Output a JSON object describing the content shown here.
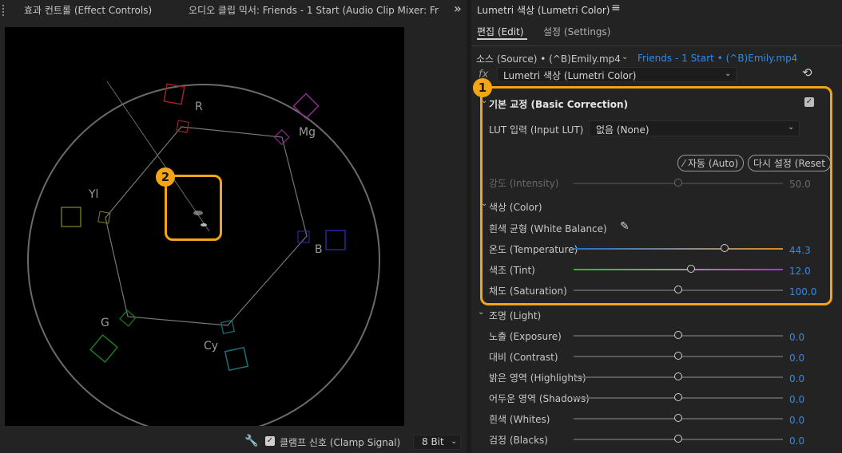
{
  "left_panel": {
    "tabs": [
      {
        "label": "효과 컨트롤 (Effect Controls)"
      },
      {
        "label": "오디오 클립 믹서: Friends - 1 Start (Audio Clip Mixer: Fr"
      }
    ],
    "overflow_symbol": "»",
    "scope_labels": {
      "r": "R",
      "mg": "Mg",
      "yl": "Yl",
      "b": "B",
      "g": "G",
      "cy": "Cy"
    },
    "footer": {
      "clamp_label": "클램프 신호 (Clamp Signal)",
      "clamp_checked": true,
      "bit_depth": "8 Bit"
    }
  },
  "right_panel": {
    "title": "Lumetri 색상 (Lumetri Color)",
    "menu_symbol": "≡",
    "tabs": [
      {
        "label": "편집 (Edit)",
        "active": true
      },
      {
        "label": "설정 (Settings)",
        "active": false
      }
    ],
    "source": {
      "label": "소스 (Source) • (^B)Emily.mp4",
      "sequence": "Friends - 1 Start • (^B)Emily.mp4"
    },
    "effect": {
      "fx": "fx",
      "name": "Lumetri 색상 (Lumetri Color)"
    },
    "basic_correction": {
      "title": "기본 교정 (Basic Correction)",
      "enabled": true,
      "lut_label": "LUT 입력 (Input LUT)",
      "lut_value": "없음 (None)",
      "auto_button": "자동 (Auto)",
      "reset_button": "다시 설정 (Reset",
      "intensity": {
        "label": "강도 (Intensity)",
        "value": "50.0",
        "fraction": 0.5
      },
      "color_section": "색상 (Color)",
      "white_balance": "흰색 균형 (White Balance)",
      "temperature": {
        "label": "온도 (Temperature)",
        "value": "44.3",
        "fraction": 0.72
      },
      "tint": {
        "label": "색조 (Tint)",
        "value": "12.0",
        "fraction": 0.56
      },
      "saturation": {
        "label": "채도 (Saturation)",
        "value": "100.0",
        "fraction": 0.5
      }
    },
    "light": {
      "section": "조명 (Light)",
      "items": [
        {
          "label": "노출 (Exposure)",
          "value": "0.0",
          "fraction": 0.5
        },
        {
          "label": "대비 (Contrast)",
          "value": "0.0",
          "fraction": 0.5
        },
        {
          "label": "밝은 영역 (Highlights)",
          "value": "0.0",
          "fraction": 0.5
        },
        {
          "label": "어두운 영역 (Shadows)",
          "value": "0.0",
          "fraction": 0.5
        },
        {
          "label": "흰색 (Whites)",
          "value": "0.0",
          "fraction": 0.5
        },
        {
          "label": "검정 (Blacks)",
          "value": "0.0",
          "fraction": 0.5
        }
      ]
    }
  },
  "annotations": {
    "badge1": "1",
    "badge2": "2"
  },
  "colors": {
    "accent_highlight": "#f3a515",
    "value_blue": "#2d8ceb"
  }
}
